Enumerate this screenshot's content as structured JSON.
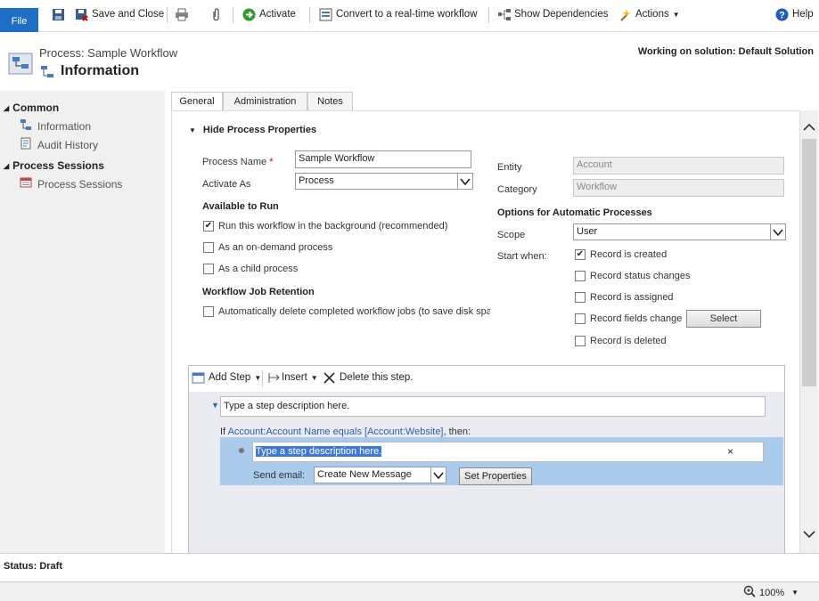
{
  "ribbon": {
    "file": "File",
    "save_close": "Save and Close",
    "activate": "Activate",
    "convert": "Convert to a real-time workflow",
    "show_deps": "Show Dependencies",
    "actions": "Actions",
    "help": "Help"
  },
  "header": {
    "subtitle": "Process: Sample Workflow",
    "title": "Information",
    "solution": "Working on solution: Default Solution"
  },
  "nav": {
    "common": "Common",
    "information": "Information",
    "audit_history": "Audit History",
    "process_sessions_header": "Process Sessions",
    "process_sessions": "Process Sessions"
  },
  "tabs": [
    "General",
    "Administration",
    "Notes"
  ],
  "section": {
    "hide_props": "Hide Process Properties"
  },
  "form": {
    "process_name_label": "Process Name",
    "required_mark": "*",
    "process_name_value": "Sample Workflow",
    "activate_as_label": "Activate As",
    "activate_as_value": "Process",
    "available_to_run": "Available to Run",
    "run_background": "Run this workflow in the background (recommended)",
    "on_demand": "As an on-demand process",
    "child_process": "As a child process",
    "retention_header": "Workflow Job Retention",
    "auto_delete": "Automatically delete completed workflow jobs (to save disk spa",
    "entity_label": "Entity",
    "entity_value": "Account",
    "category_label": "Category",
    "category_value": "Workflow",
    "options_header": "Options for Automatic Processes",
    "scope_label": "Scope",
    "scope_value": "User",
    "start_when_label": "Start when:",
    "record_created": "Record is created",
    "record_status": "Record status changes",
    "record_assigned": "Record is assigned",
    "record_fields": "Record fields change",
    "select_btn": "Select",
    "record_deleted": "Record is deleted"
  },
  "designer": {
    "add_step": "Add Step",
    "insert": "Insert",
    "delete_step": "Delete this step.",
    "step_desc_placeholder": "Type a step description here.",
    "condition_prefix": "If ",
    "condition_link": "Account:Account Name equals [Account:Website]",
    "condition_suffix": ", then:",
    "inner_desc": "Type a step description here.",
    "send_email_label": "Send email:",
    "send_email_value": "Create New Message",
    "set_props": "Set Properties"
  },
  "status": {
    "text": "Status: Draft",
    "zoom": "100%"
  }
}
